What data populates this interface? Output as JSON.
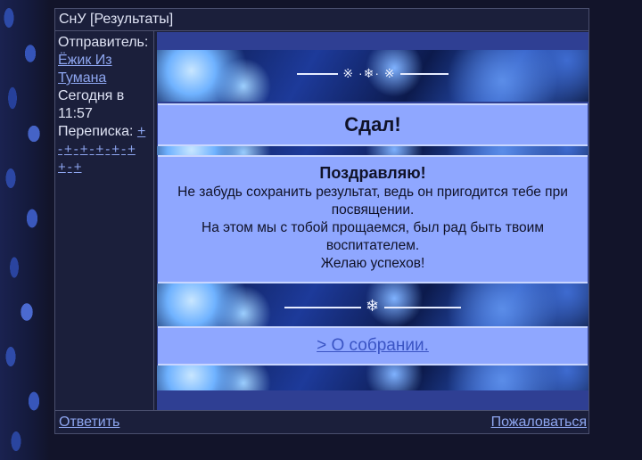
{
  "topic": {
    "title": "СнУ [Результаты]"
  },
  "sidebar": {
    "sender_label": "Отправитель:",
    "sender_name_line1": "Ёжик Из",
    "sender_name_line2": "Тумана",
    "date_line1": "Сегодня в",
    "date_line2": "11:57",
    "correspondence_label": "Переписка:",
    "pm_links": [
      "+",
      "-",
      "+",
      "-",
      "+",
      "-",
      "+",
      "-",
      "+",
      "-",
      "+",
      "+",
      "-",
      "+"
    ]
  },
  "post": {
    "ornament_top": "※ ·❄· ※",
    "ornament_mid": "❄",
    "headline": "Сдал!",
    "congrats_title": "Поздравляю!",
    "line1": "Не забудь сохранить результат, ведь он пригодится тебе при посвящении.",
    "line2": "На этом мы с тобой прощаемся, был рад быть твоим воспитателем.",
    "line3": "Желаю успехов!",
    "meeting_link": "> О собрании."
  },
  "footer": {
    "reply": "Ответить",
    "report": "Пожаловаться"
  },
  "colors": {
    "page_bg": "#12142a",
    "panel": "#8fa7ff",
    "link": "#8ea6f0"
  }
}
